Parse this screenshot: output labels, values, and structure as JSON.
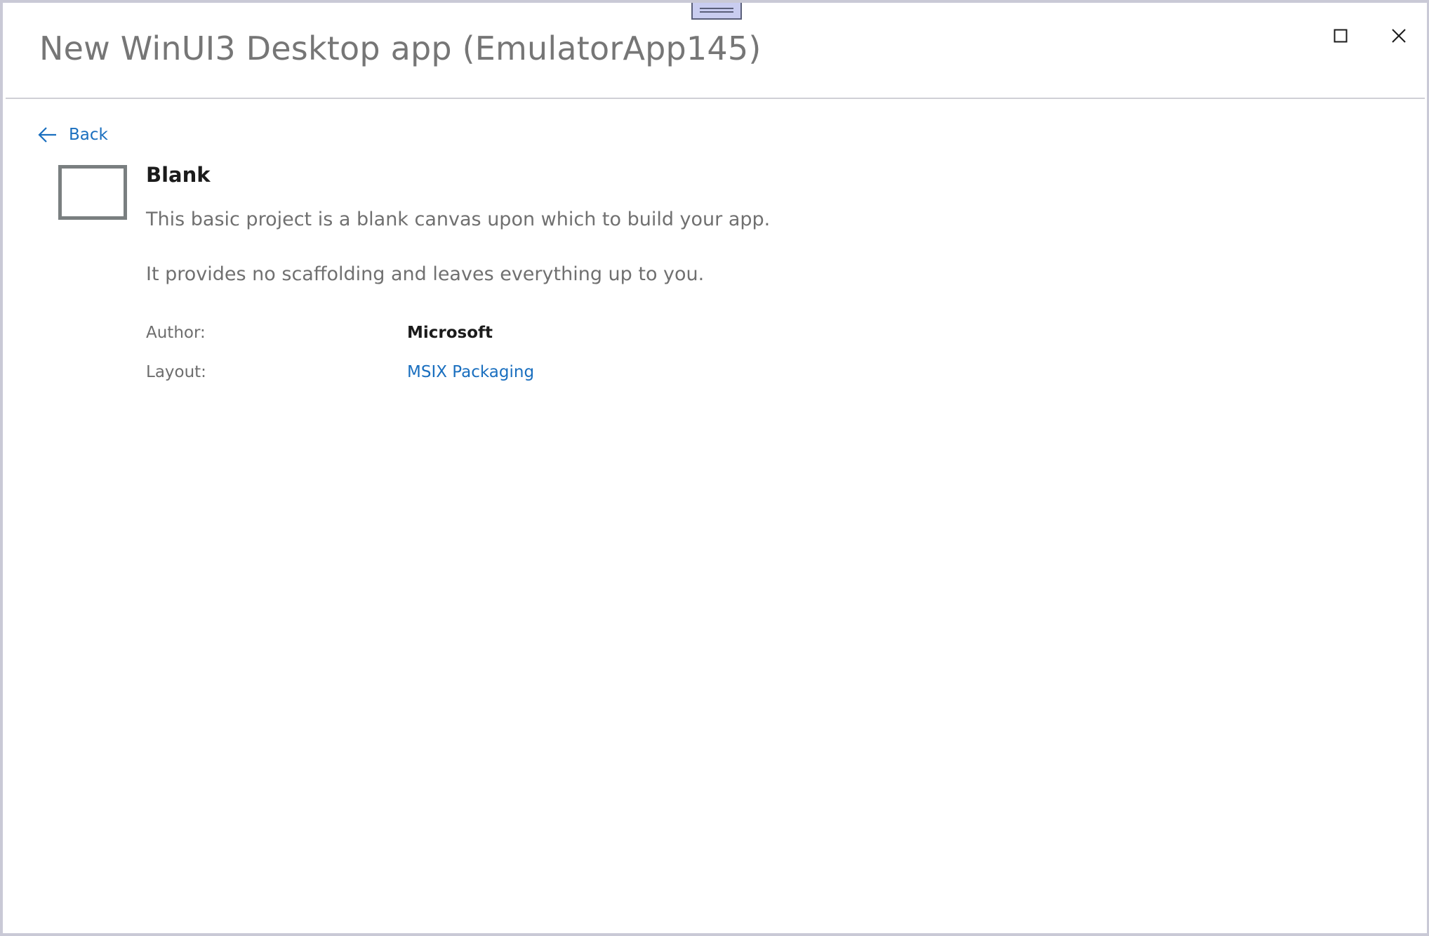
{
  "window": {
    "title": "New WinUI3 Desktop app (EmulatorApp145)",
    "controls": {
      "maximize_icon": "maximize-icon",
      "close_icon": "close-icon"
    }
  },
  "navigation": {
    "back_label": "Back",
    "back_icon": "arrow-left-icon"
  },
  "template": {
    "icon": "blank-template-icon",
    "name": "Blank",
    "description_1": "This basic project is a blank canvas upon which to build your app.",
    "description_2": "It provides no scaffolding and leaves everything up to you.",
    "details": {
      "author_label": "Author:",
      "author_value": "Microsoft",
      "layout_label": "Layout:",
      "layout_value": "MSIX Packaging"
    }
  },
  "colors": {
    "accent": "#1a6fbf",
    "title_text": "#767676",
    "body_text": "#707070",
    "window_border": "#c9c9d6"
  }
}
